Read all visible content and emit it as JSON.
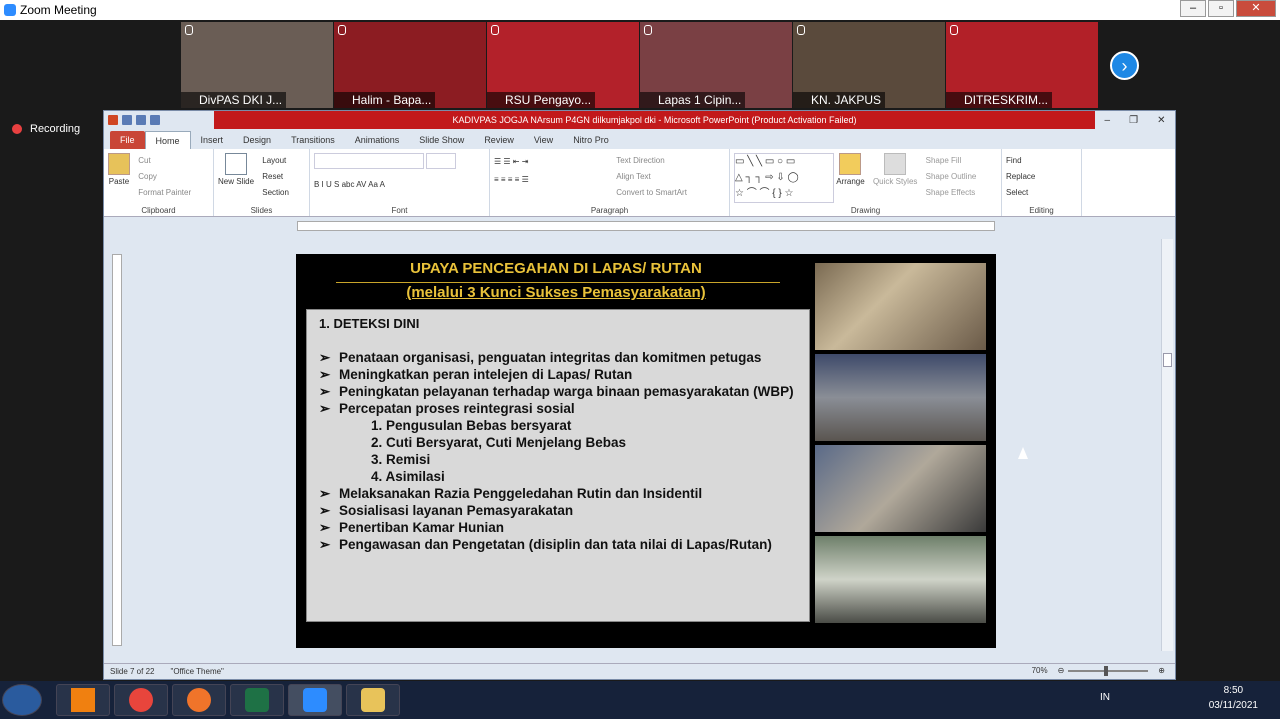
{
  "zoom": {
    "window_title": "Zoom Meeting",
    "recording": "Recording",
    "next": "›"
  },
  "participants": [
    {
      "name": "DivPAS DKI J...",
      "bg": "#6a5d55"
    },
    {
      "name": "Halim - Bapa...",
      "bg": "#8c1c22"
    },
    {
      "name": "RSU Pengayo...",
      "bg": "#b3212a"
    },
    {
      "name": "Lapas 1 Cipin...",
      "bg": "#7a4044"
    },
    {
      "name": "KN. JAKPUS",
      "bg": "#5a4a3c"
    },
    {
      "name": "DITRESKRIM...",
      "bg": "#b22028"
    }
  ],
  "ppt": {
    "title": "KADIVPAS JOGJA NArsum P4GN  dilkumjakpol dki  -  Microsoft PowerPoint (Product Activation Failed)",
    "tabs": [
      "File",
      "Home",
      "Insert",
      "Design",
      "Transitions",
      "Animations",
      "Slide Show",
      "Review",
      "View",
      "Nitro Pro"
    ],
    "ribbon": {
      "clipboard": {
        "label": "Clipboard",
        "paste": "Paste",
        "cut": "Cut",
        "copy": "Copy",
        "painter": "Format Painter"
      },
      "slides": {
        "label": "Slides",
        "new": "New Slide",
        "layout": "Layout",
        "reset": "Reset",
        "section": "Section"
      },
      "font": {
        "label": "Font"
      },
      "paragraph": {
        "label": "Paragraph",
        "dir": "Text Direction",
        "align": "Align Text",
        "smart": "Convert to SmartArt"
      },
      "drawing": {
        "label": "Drawing",
        "arrange": "Arrange",
        "quick": "Quick Styles",
        "fill": "Shape Fill",
        "outline": "Shape Outline",
        "effects": "Shape Effects"
      },
      "editing": {
        "label": "Editing",
        "find": "Find",
        "replace": "Replace",
        "select": "Select"
      }
    },
    "status": {
      "slide": "Slide 7 of 22",
      "theme": "\"Office Theme\"",
      "zoom": "70%"
    }
  },
  "slide": {
    "title": "UPAYA PENCEGAHAN DI LAPAS/ RUTAN",
    "subtitle": "(melalui  3 Kunci  Sukses  Pemasyarakatan)",
    "heading": "1. DETEKSI DINI",
    "bullets": [
      "Penataan organisasi, penguatan integritas dan komitmen petugas",
      "Meningkatkan peran intelejen di Lapas/ Rutan",
      "Peningkatan pelayanan terhadap warga binaan pemasyarakatan (WBP)",
      "Percepatan proses reintegrasi sosial"
    ],
    "subitems": [
      "1. Pengusulan Bebas bersyarat",
      "2. Cuti Bersyarat, Cuti Menjelang Bebas",
      "3. Remisi",
      "4. Asimilasi"
    ],
    "bullets2": [
      "Melaksanakan Razia Penggeledahan Rutin dan Insidentil",
      "Sosialisasi layanan Pemasyarakatan",
      "Penertiban Kamar Hunian",
      "Pengawasan dan Pengetatan (disiplin dan tata nilai di Lapas/Rutan)"
    ]
  },
  "taskbar": {
    "lang": "IN",
    "time": "8:50",
    "date": "03/11/2021"
  }
}
